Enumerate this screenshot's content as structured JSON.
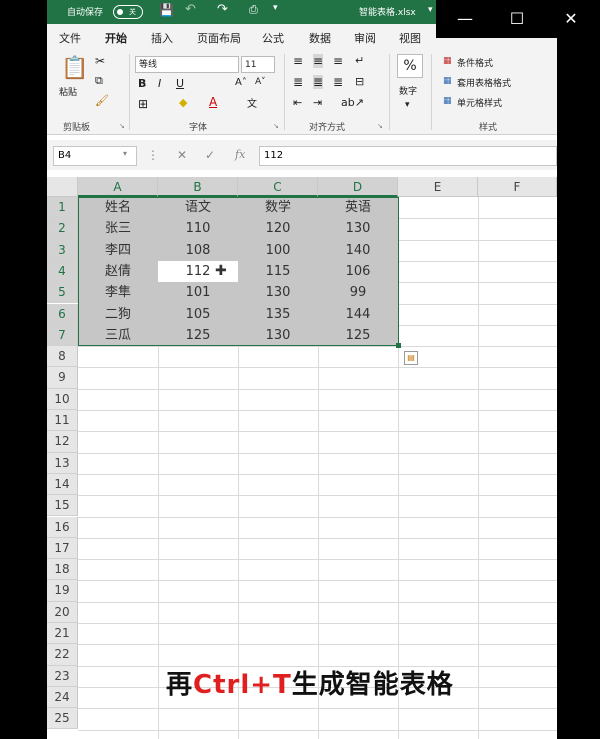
{
  "titlebar": {
    "autosave_label": "自动保存",
    "autosave_state": "关",
    "file_name": "智能表格.xlsx"
  },
  "window_controls": {
    "minimize": "—",
    "maximize": "☐",
    "close": "✕"
  },
  "tabs": [
    "文件",
    "开始",
    "插入",
    "页面布局",
    "公式",
    "数据",
    "审阅",
    "视图"
  ],
  "active_tab": "开始",
  "ribbon": {
    "clipboard": {
      "paste_label": "粘贴",
      "group_label": "剪贴板"
    },
    "font": {
      "font_name": "等线",
      "font_size": "11",
      "group_label": "字体"
    },
    "alignment": {
      "group_label": "对齐方式"
    },
    "number": {
      "label": "数字",
      "icon": "%"
    },
    "styles": {
      "conditional_format": "条件格式",
      "table_format": "套用表格格式",
      "cell_style": "单元格样式",
      "group_label": "样式"
    }
  },
  "formula_bar": {
    "name_box": "B4",
    "fx": "fx",
    "value": "112"
  },
  "sheet": {
    "columns": [
      "A",
      "B",
      "C",
      "D",
      "E",
      "F"
    ],
    "rows": [
      "1",
      "2",
      "3",
      "4",
      "5",
      "6",
      "7",
      "8",
      "9",
      "10",
      "11",
      "12",
      "13",
      "14",
      "15",
      "16",
      "17",
      "18",
      "19",
      "20",
      "21",
      "22",
      "23",
      "24",
      "25"
    ],
    "data": [
      [
        "姓名",
        "语文",
        "数学",
        "英语"
      ],
      [
        "张三",
        "110",
        "120",
        "130"
      ],
      [
        "李四",
        "108",
        "100",
        "140"
      ],
      [
        "赵倩",
        "112",
        "115",
        "106"
      ],
      [
        "李隼",
        "101",
        "130",
        "99"
      ],
      [
        "二狗",
        "105",
        "135",
        "144"
      ],
      [
        "三瓜",
        "125",
        "130",
        "125"
      ]
    ]
  },
  "caption": {
    "part1": "再",
    "part2": "Ctrl+T",
    "part3": "生成智能表格"
  },
  "colors": {
    "excel_green": "#217346",
    "caption_red": "#e02020"
  }
}
